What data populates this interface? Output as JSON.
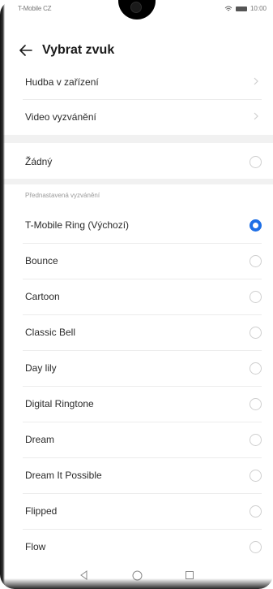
{
  "status_bar": {
    "carrier": "T-Mobile CZ",
    "time": "10:00"
  },
  "header": {
    "title": "Vybrat zvuk"
  },
  "nav_items": [
    {
      "label": "Hudba v zařízení"
    },
    {
      "label": "Video vyzvánění"
    }
  ],
  "none_item": {
    "label": "Žádný"
  },
  "section": {
    "title": "Přednastavená vyzvánění"
  },
  "ringtones": [
    {
      "label": "T-Mobile Ring (Výchozí)",
      "selected": true
    },
    {
      "label": "Bounce",
      "selected": false
    },
    {
      "label": "Cartoon",
      "selected": false
    },
    {
      "label": "Classic Bell",
      "selected": false
    },
    {
      "label": "Day lily",
      "selected": false
    },
    {
      "label": "Digital Ringtone",
      "selected": false
    },
    {
      "label": "Dream",
      "selected": false
    },
    {
      "label": "Dream It Possible",
      "selected": false
    },
    {
      "label": "Flipped",
      "selected": false
    },
    {
      "label": "Flow",
      "selected": false
    }
  ],
  "colors": {
    "accent": "#1e6fe6",
    "text": "#2a2a2a",
    "secondary": "#9a9a9a",
    "separator": "#f1f1f1"
  },
  "icons": {
    "back": "arrow-left-icon",
    "chevron": "chevron-right-icon",
    "nav_back": "triangle-back-icon",
    "nav_home": "circle-home-icon",
    "nav_recents": "square-recents-icon"
  }
}
